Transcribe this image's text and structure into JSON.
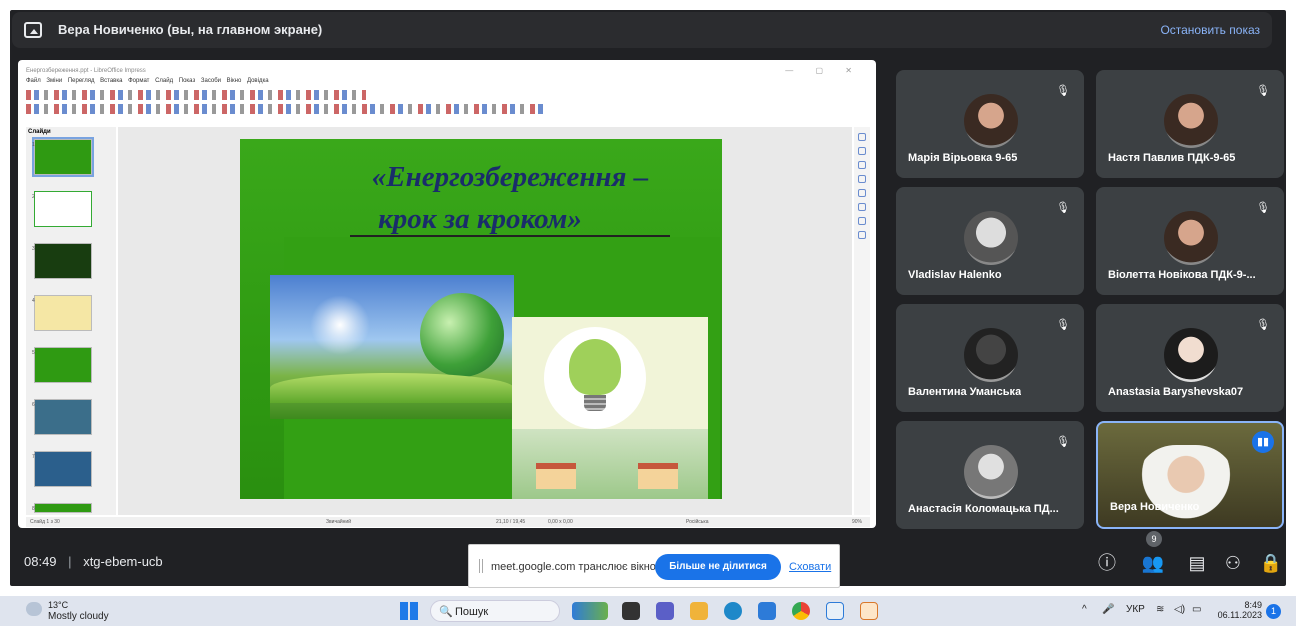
{
  "meet": {
    "presenter_banner": "Вера Новиченко (вы, на главном экране)",
    "stop_sharing": "Остановить показ",
    "time": "08:49",
    "separator": "|",
    "meeting_code": "xtg-ebem-ucb",
    "people_count": "9",
    "participants": [
      {
        "name": "Марія Вірьовка 9-65",
        "muted": true
      },
      {
        "name": "Настя Павлив ПДК-9-65",
        "muted": true
      },
      {
        "name": "Vladislav Halenko",
        "muted": true
      },
      {
        "name": "Віолетта Новікова ПДК-9-...",
        "muted": true
      },
      {
        "name": "Валентина Уманська",
        "muted": true
      },
      {
        "name": "Anastasia Baryshevska07",
        "muted": true
      },
      {
        "name": "Анастасія Коломацька ПД...",
        "muted": true
      },
      {
        "name": "Вера Новиченко",
        "muted": false
      }
    ]
  },
  "impress": {
    "window_title": "Енергозбереження.ppt - LibreOffice Impress",
    "menu": "Файл Зміни Перегляд Вставка Формат Слайд Показ Засоби Вікно Довідка",
    "slides_panel_title": "Слайди",
    "slide_title_line1": "«Енергозбереження –",
    "slide_title_line2": "крок за кроком»",
    "status": {
      "slide": "Слайд 1 з 30",
      "layout": "Звичайний",
      "position": "21,10 / 19,45",
      "size": "0,00 x 0,00",
      "language": "Російська",
      "zoom": "90%"
    },
    "thumb_numbers": [
      "1",
      "2",
      "3",
      "4",
      "5",
      "6",
      "7",
      "8"
    ]
  },
  "share_bar": {
    "message": "meet.google.com транслює вікно.",
    "stop_button": "Більше не ділитися",
    "hide_link": "Сховати"
  },
  "taskbar": {
    "temperature": "13°C",
    "weather": "Mostly cloudy",
    "search_placeholder": "Пошук",
    "language": "УКР",
    "clock_time": "8:49",
    "clock_date": "06.11.2023",
    "notifications": "1"
  },
  "colors": {
    "accent": "#8ab4f8",
    "meet_bg": "#202124",
    "tile_bg": "#3c4043",
    "primary_blue": "#1a73e8"
  }
}
